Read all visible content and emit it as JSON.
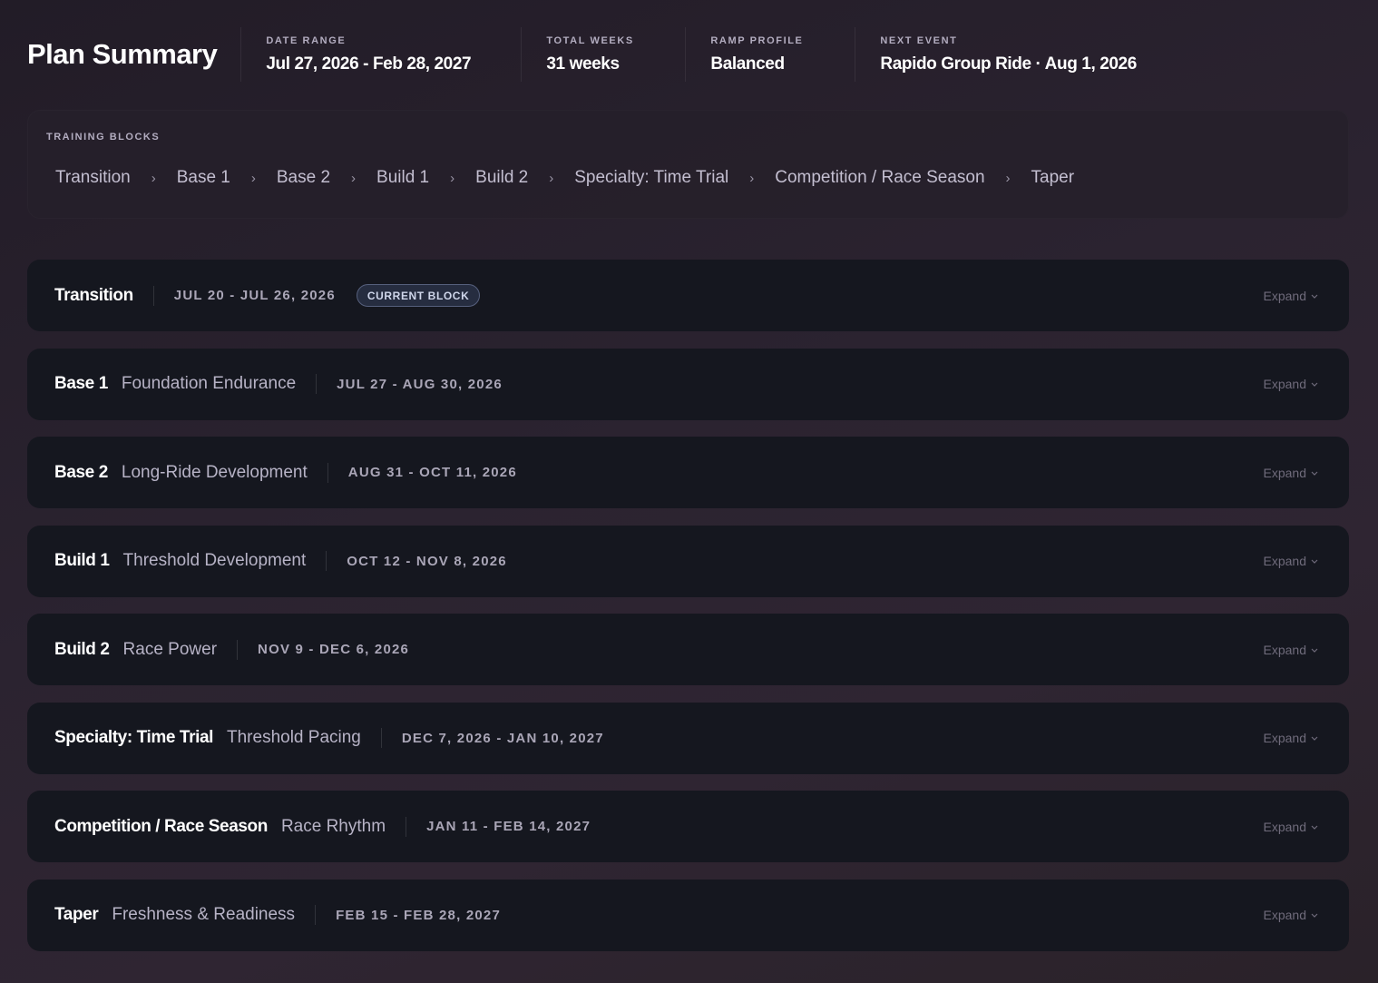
{
  "header": {
    "title": "Plan Summary",
    "stats": [
      {
        "label": "DATE RANGE",
        "value": "Jul 27, 2026 - Feb 28, 2027"
      },
      {
        "label": "TOTAL WEEKS",
        "value": "31 weeks"
      },
      {
        "label": "RAMP PROFILE",
        "value": "Balanced"
      },
      {
        "label": "NEXT EVENT",
        "value": "Rapido Group Ride · Aug 1, 2026"
      }
    ]
  },
  "training_blocks": {
    "label": "TRAINING BLOCKS",
    "items": [
      "Transition",
      "Base 1",
      "Base 2",
      "Build 1",
      "Build 2",
      "Specialty: Time Trial",
      "Competition / Race Season",
      "Taper"
    ]
  },
  "phases": [
    {
      "name": "Transition",
      "subtitle": "",
      "dates": "JUL 20 - JUL 26, 2026",
      "badge": "CURRENT BLOCK",
      "expand": "Expand"
    },
    {
      "name": "Base 1",
      "subtitle": "Foundation Endurance",
      "dates": "JUL 27 - AUG 30, 2026",
      "expand": "Expand"
    },
    {
      "name": "Base 2",
      "subtitle": "Long-Ride Development",
      "dates": "AUG 31 - OCT 11, 2026",
      "expand": "Expand"
    },
    {
      "name": "Build 1",
      "subtitle": "Threshold Development",
      "dates": "OCT 12 - NOV 8, 2026",
      "expand": "Expand"
    },
    {
      "name": "Build 2",
      "subtitle": "Race Power",
      "dates": "NOV 9 - DEC 6, 2026",
      "expand": "Expand"
    },
    {
      "name": "Specialty: Time Trial",
      "subtitle": "Threshold Pacing",
      "dates": "DEC 7, 2026 - JAN 10, 2027",
      "expand": "Expand"
    },
    {
      "name": "Competition / Race Season",
      "subtitle": "Race Rhythm",
      "dates": "JAN 11 - FEB 14, 2027",
      "expand": "Expand"
    },
    {
      "name": "Taper",
      "subtitle": "Freshness & Readiness",
      "dates": "FEB 15 - FEB 28, 2027",
      "expand": "Expand"
    }
  ],
  "icons": {
    "breadcrumb_separator": "chevron-right-icon",
    "expand": "chevron-down-icon"
  },
  "colors": {
    "background": "#2a2229",
    "row_background": "#15171f",
    "badge_border": "#56607d"
  }
}
